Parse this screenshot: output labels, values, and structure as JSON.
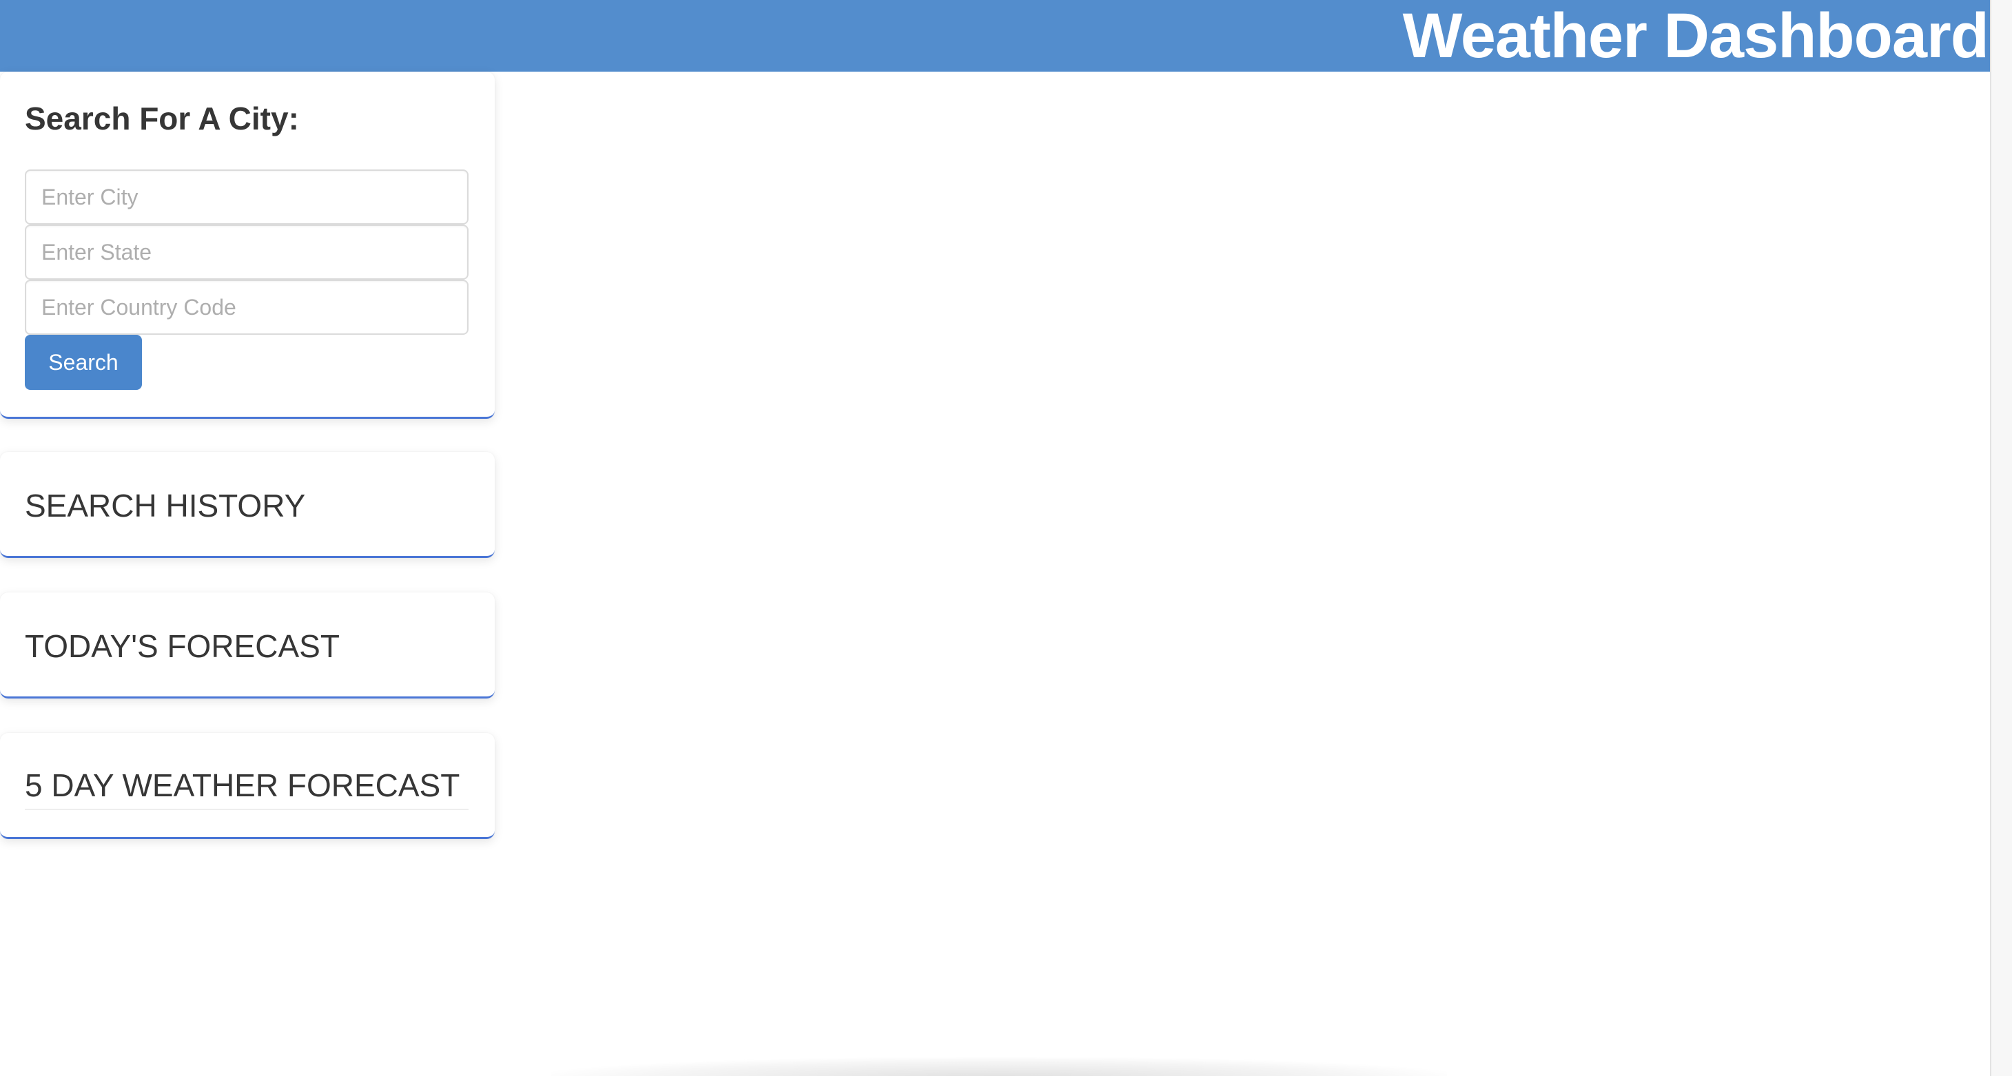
{
  "header": {
    "title": "Weather Dashboard"
  },
  "search": {
    "heading": "Search For A City:",
    "city_placeholder": "Enter City",
    "state_placeholder": "Enter State",
    "country_placeholder": "Enter Country Code",
    "button_label": "Search"
  },
  "sections": {
    "history_title": "SEARCH HISTORY",
    "today_title": "TODAY'S FORECAST",
    "fiveday_title": "5 DAY WEATHER FORECAST"
  },
  "colors": {
    "header_bg": "#538dcd",
    "button_bg": "#4a86cc",
    "card_accent": "#4a76d6"
  }
}
